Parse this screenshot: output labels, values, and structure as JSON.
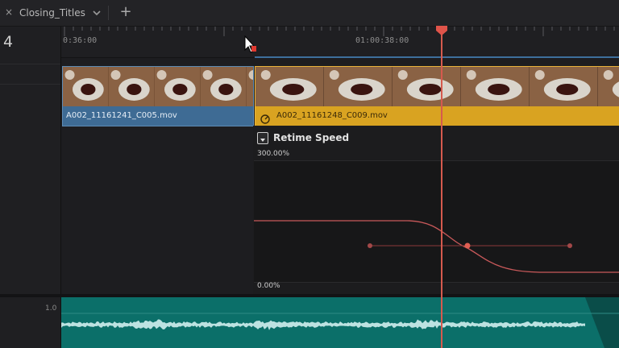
{
  "tab": {
    "title": "Closing_Titles",
    "close_icon": "close-icon",
    "dropdown_icon": "chevron-down-icon",
    "add_icon": "plus-icon",
    "add_label": "+",
    "close_label": "×"
  },
  "track": {
    "number": "4"
  },
  "ruler": {
    "timecode_left": "0:36:00",
    "timecode_right": "01:00:38:00"
  },
  "clips": {
    "clip1": {
      "name": "A002_11161241_C005.mov",
      "color": "#3e6b94"
    },
    "clip2": {
      "name": "A002_11161248_C009.mov",
      "color": "#d9a321"
    }
  },
  "retime": {
    "title": "Retime Speed",
    "max_label": "300.00%",
    "min_label": "0.00%",
    "curve_color": "#c9595a"
  },
  "audio": {
    "level": "1.0",
    "color": "#0b6f69"
  },
  "playhead": {
    "color": "#d65a4e"
  }
}
